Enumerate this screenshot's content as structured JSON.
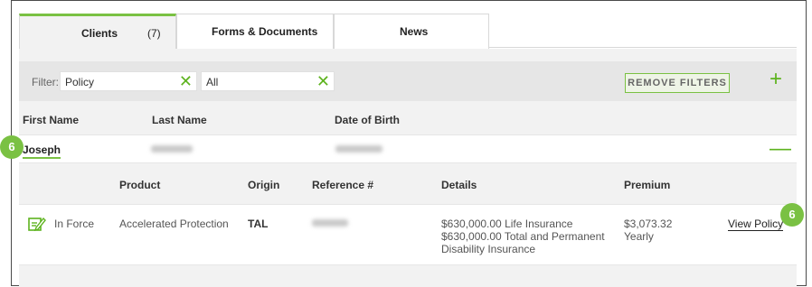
{
  "tabs": [
    {
      "label": "Clients",
      "count": "(7)"
    },
    {
      "label": "Forms & Documents"
    },
    {
      "label": "News"
    }
  ],
  "filter": {
    "label": "Filter:",
    "field1_value": "Policy",
    "field2_value": "All",
    "remove_label": "REMOVE FILTERS"
  },
  "columns": {
    "first_name": "First Name",
    "last_name": "Last Name",
    "dob": "Date of Birth"
  },
  "client": {
    "first_name": "Joseph"
  },
  "policy_columns": {
    "product": "Product",
    "origin": "Origin",
    "reference": "Reference #",
    "details": "Details",
    "premium": "Premium"
  },
  "policy": {
    "status": "In Force",
    "product": "Accelerated Protection",
    "origin": "TAL",
    "details_line1": "$630,000.00 Life Insurance",
    "details_line2": "$630,000.00 Total and Permanent",
    "details_line3": "Disability Insurance",
    "premium_amount": "$3,073.32",
    "premium_freq": "Yearly",
    "view_label": "View Policy"
  },
  "badges": {
    "client_badge": "6",
    "view_badge": "6"
  },
  "colors": {
    "accent": "#7ac143",
    "icon_green": "#5db31e"
  }
}
